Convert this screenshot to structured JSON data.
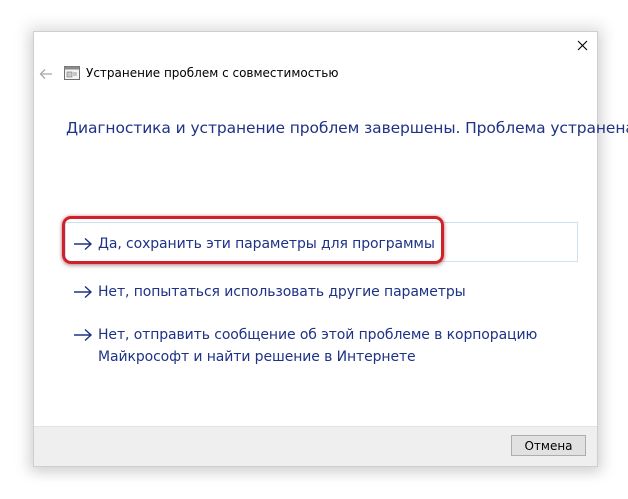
{
  "window": {
    "title": "Устранение проблем с совместимостью",
    "close_icon": "close-icon",
    "back_icon": "back-arrow-icon",
    "app_icon": "compatibility-troubleshooter-icon"
  },
  "content": {
    "heading": "Диагностика и устранение проблем завершены. Проблема устранена?",
    "options": [
      {
        "label": "Да, сохранить эти параметры для программы",
        "icon": "arrow-right-icon",
        "highlighted": true
      },
      {
        "label": "Нет, попытаться использовать другие параметры",
        "icon": "arrow-right-icon"
      },
      {
        "label": "Нет, отправить сообщение об этой проблеме в корпорацию Майкрософт и найти решение в Интернете",
        "icon": "arrow-right-icon"
      }
    ]
  },
  "footer": {
    "cancel_label": "Отмена"
  },
  "colors": {
    "link": "#1e3287",
    "highlight": "#d0202a",
    "footer_bg": "#efefef"
  }
}
